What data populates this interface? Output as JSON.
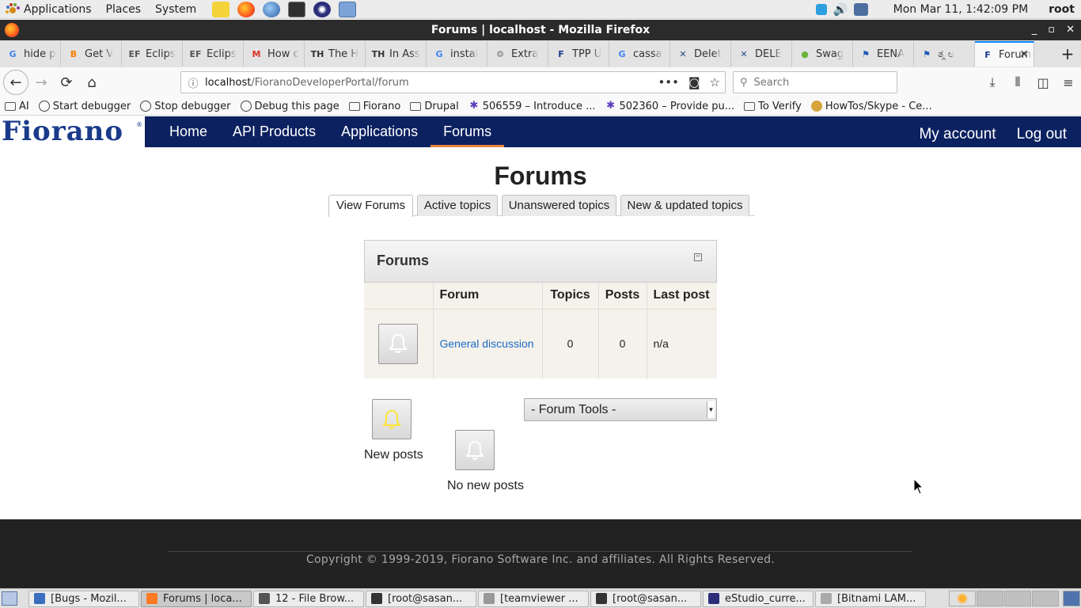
{
  "desktop": {
    "menus": [
      "Applications",
      "Places",
      "System"
    ],
    "clock": "Mon Mar 11,  1:42:09 PM",
    "user": "root"
  },
  "window": {
    "title": "Forums | localhost - Mozilla Firefox"
  },
  "tabs": [
    {
      "icon": "G",
      "label": "hide p",
      "color": "#4285f4"
    },
    {
      "icon": "B",
      "label": "Get V",
      "color": "#f57d00"
    },
    {
      "icon": "EF",
      "label": "Eclips",
      "color": "#555555"
    },
    {
      "icon": "EF",
      "label": "Eclips",
      "color": "#555555"
    },
    {
      "icon": "M",
      "label": "How c",
      "color": "#d93025"
    },
    {
      "icon": "TH",
      "label": "The H",
      "color": "#333333"
    },
    {
      "icon": "TH",
      "label": "In Ass",
      "color": "#333333"
    },
    {
      "icon": "G",
      "label": "instal",
      "color": "#4285f4"
    },
    {
      "icon": "⚙",
      "label": "Extra",
      "color": "#777777"
    },
    {
      "icon": "F",
      "label": "TPP U",
      "color": "#1a3a8a"
    },
    {
      "icon": "G",
      "label": "cassa",
      "color": "#4285f4"
    },
    {
      "icon": "✕",
      "label": "Delet",
      "color": "#2a4d8a"
    },
    {
      "icon": "✕",
      "label": "DELE",
      "color": "#2a4d8a"
    },
    {
      "icon": "●",
      "label": "Swag",
      "color": "#6cb33e"
    },
    {
      "icon": "⚑",
      "label": "EENA",
      "color": "#1e57b4"
    },
    {
      "icon": "⚑",
      "label": "ತ್ಮ ಅ",
      "color": "#1e57b4"
    },
    {
      "icon": "F",
      "label": "Forums",
      "color": "#1a3a8a",
      "active": true
    }
  ],
  "urlbar": {
    "host": "localhost",
    "path": "/FioranoDeveloperPortal/forum"
  },
  "searchbar": {
    "placeholder": "Search"
  },
  "bookmarks": [
    {
      "type": "folder",
      "label": "AI"
    },
    {
      "type": "globe",
      "label": "Start debugger"
    },
    {
      "type": "globe",
      "label": "Stop debugger"
    },
    {
      "type": "globe",
      "label": "Debug this page"
    },
    {
      "type": "folder",
      "label": "Fiorano"
    },
    {
      "type": "folder",
      "label": "Drupal"
    },
    {
      "type": "bug",
      "label": "506559 – Introduce ..."
    },
    {
      "type": "bug",
      "label": "502360 – Provide pu..."
    },
    {
      "type": "folder",
      "label": "To Verify"
    },
    {
      "type": "skype",
      "label": "HowTos/Skype - Ce..."
    }
  ],
  "site": {
    "logo": "Fiorano",
    "logo_mark": "®",
    "nav": [
      "Home",
      "API Products",
      "Applications",
      "Forums"
    ],
    "active_nav": "Forums",
    "user_nav": [
      "My account",
      "Log out"
    ]
  },
  "page": {
    "title": "Forums",
    "subtabs": [
      "View Forums",
      "Active topics",
      "Unanswered topics",
      "New & updated topics"
    ],
    "active_subtab": "View Forums"
  },
  "forum_container": {
    "heading": "Forums",
    "collapse_glyph": "−",
    "columns": [
      "",
      "Forum",
      "Topics",
      "Posts",
      "Last post"
    ],
    "rows": [
      {
        "name": "General discussion",
        "topics": "0",
        "posts": "0",
        "last_post": "n/a"
      }
    ]
  },
  "legend": {
    "new_posts": "New posts",
    "no_new_posts": "No new posts"
  },
  "forum_tools": {
    "selected": "- Forum Tools -"
  },
  "footer": {
    "copyright": "Copyright © 1999-2019, Fiorano Software Inc. and affiliates. All Rights Reserved."
  },
  "taskbar": [
    {
      "label": "[Bugs - Mozil...",
      "color": "#3c6ebf"
    },
    {
      "label": "Forums | loca...",
      "color": "#ff7a22",
      "active": true
    },
    {
      "label": "12 - File Brow...",
      "color": "#555555"
    },
    {
      "label": "[root@sasan...",
      "color": "#333333"
    },
    {
      "label": "[teamviewer ...",
      "color": "#999999"
    },
    {
      "label": "[root@sasan...",
      "color": "#333333"
    },
    {
      "label": "eStudio_curre...",
      "color": "#2c2e7a"
    },
    {
      "label": "[Bitnami LAM...",
      "color": "#aaaaaa"
    }
  ]
}
